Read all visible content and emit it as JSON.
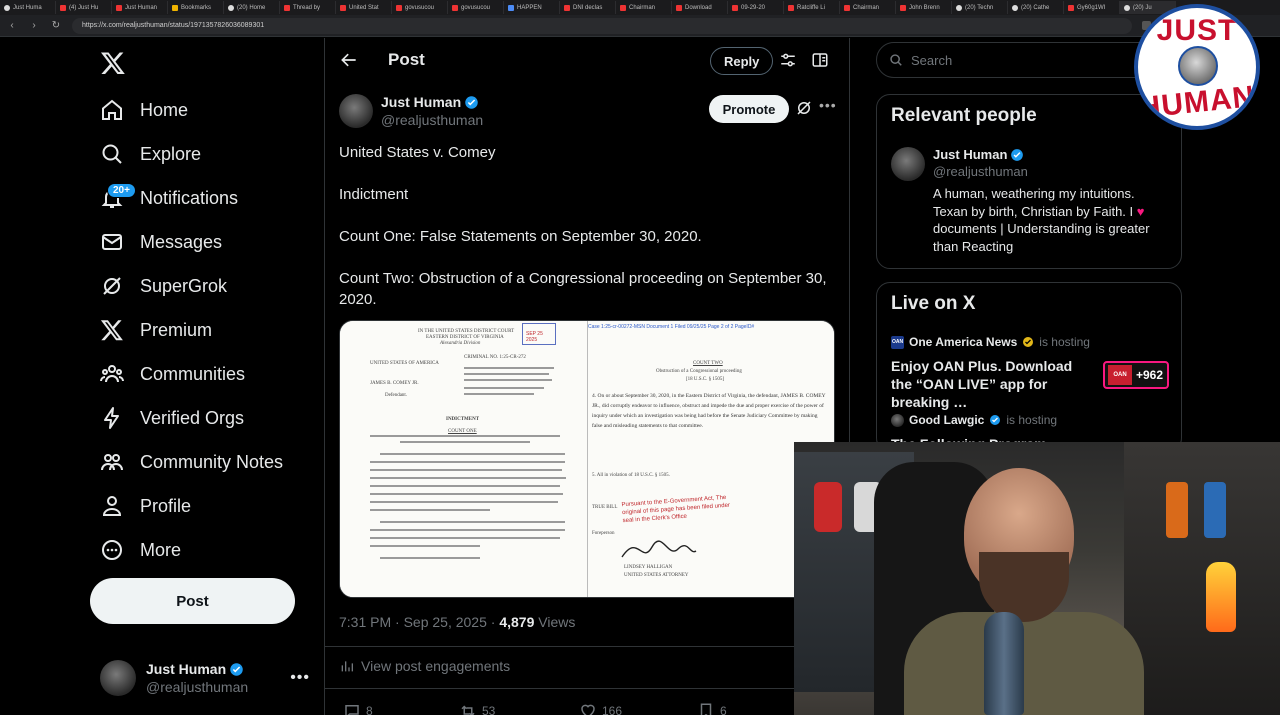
{
  "browser": {
    "url": "https://x.com/realjusthuman/status/1971357826036089301",
    "tabs": [
      "Just Huma",
      "(4) Just Hu",
      "Just Human",
      "Bookmarks",
      "(20) Home",
      "Thread by",
      "United Stat",
      "govusucou",
      "govusucou",
      "HAPPEN",
      "DNI declas",
      "Chairman",
      "Download",
      "09-29-20",
      "Ratcliffe Li",
      "Chairman",
      "John Brenn",
      "(20) Techn",
      "(20) Cathe",
      "Gy60g1WI",
      "(20) Ju"
    ]
  },
  "leftnav": {
    "items": [
      {
        "label": "Home",
        "icon": "home-icon"
      },
      {
        "label": "Explore",
        "icon": "search-icon"
      },
      {
        "label": "Notifications",
        "icon": "bell-icon",
        "badge": "20+"
      },
      {
        "label": "Messages",
        "icon": "mail-icon"
      },
      {
        "label": "SuperGrok",
        "icon": "grok-icon"
      },
      {
        "label": "Premium",
        "icon": "x-icon"
      },
      {
        "label": "Communities",
        "icon": "people-icon"
      },
      {
        "label": "Verified Orgs",
        "icon": "lightning-icon"
      },
      {
        "label": "Community Notes",
        "icon": "notes-icon"
      },
      {
        "label": "Profile",
        "icon": "person-icon"
      },
      {
        "label": "More",
        "icon": "more-circle-icon"
      }
    ],
    "post_button": "Post",
    "account": {
      "name": "Just Human",
      "handle": "@realjusthuman"
    }
  },
  "main": {
    "header_title": "Post",
    "reply_button": "Reply",
    "author": {
      "name": "Just Human",
      "handle": "@realjusthuman"
    },
    "promote_button": "Promote",
    "text": [
      "United States v. Comey",
      "Indictment",
      "Count One: False Statements on September 30, 2020.",
      "Count Two: Obstruction of a Congressional proceeding on September 30, 2020."
    ],
    "document_left": {
      "court_header": "IN THE UNITED STATES DISTRICT COURT",
      "court_district": "EASTERN DISTRICT OF VIRGINIA",
      "court_division": "Alexandria Division",
      "plaintiff": "UNITED STATES OF AMERICA",
      "defendant": "JAMES B. COMEY JR.",
      "defendant_role": "Defendant.",
      "criminal_no": "CRIMINAL NO. 1:25-CR-272",
      "indictment": "INDICTMENT",
      "count_one": "COUNT ONE",
      "stamp": "SEP 25 2025"
    },
    "document_right": {
      "case_header": "Case 1:25-cr-00272-MSN   Document 1   Filed 09/25/25   Page 2 of 2 PageID#",
      "count_two": "COUNT TWO",
      "count_two_sub": "Obstruction of a Congressional proceeding",
      "statute": "[18 U.S.C. § 1505]",
      "para4": "4.   On or about September 30, 2020, in the Eastern District of Virginia, the defendant, JAMES B. COMEY JR., did corruptly endeavor to influence, obstruct and impede the due and proper exercise of the power of inquiry under which an investigation was being had before the Senate Judiciary Committee by making false and misleading statements to that committee.",
      "para5": "5.   All in violation of 18 U.S.C. § 1505.",
      "true_bill": "TRUE BILL",
      "egov_stamp": "Pursuant to the E-Government Act, The original of this page has been filed under seal in the Clerk's Office",
      "foreperson": "Foreperson",
      "signer": "LINDSEY HALLIGAN",
      "signer_title": "UNITED STATES ATTORNEY"
    },
    "meta": {
      "time": "7:31 PM · Sep 25, 2025 · ",
      "views_count": "4,879",
      "views_label": " Views"
    },
    "engagements": "View post engagements",
    "stats": {
      "replies": "8",
      "reposts": "53",
      "likes": "166",
      "bookmarks": "6"
    }
  },
  "right": {
    "search_placeholder": "Search",
    "relevant": {
      "title": "Relevant people",
      "name": "Just Human",
      "handle": "@realjusthuman",
      "bio_1": "A human, weathering my intuitions. Texan by birth, Christian by Faith. I ",
      "bio_heart": "♥",
      "bio_2": " documents | Understanding is greater than Reacting"
    },
    "live": {
      "title": "Live on X",
      "items": [
        {
          "host": "One America News",
          "hosting": "is hosting",
          "title": "Enjoy OAN Plus. Download the “OAN LIVE” app for breaking …",
          "count": "+962"
        },
        {
          "host": "Good Lawgic",
          "hosting": "is hosting",
          "title": "The Following Program: Comey"
        }
      ]
    }
  },
  "brand_logo": {
    "top": "JUST",
    "bottom": "HUMAN"
  }
}
